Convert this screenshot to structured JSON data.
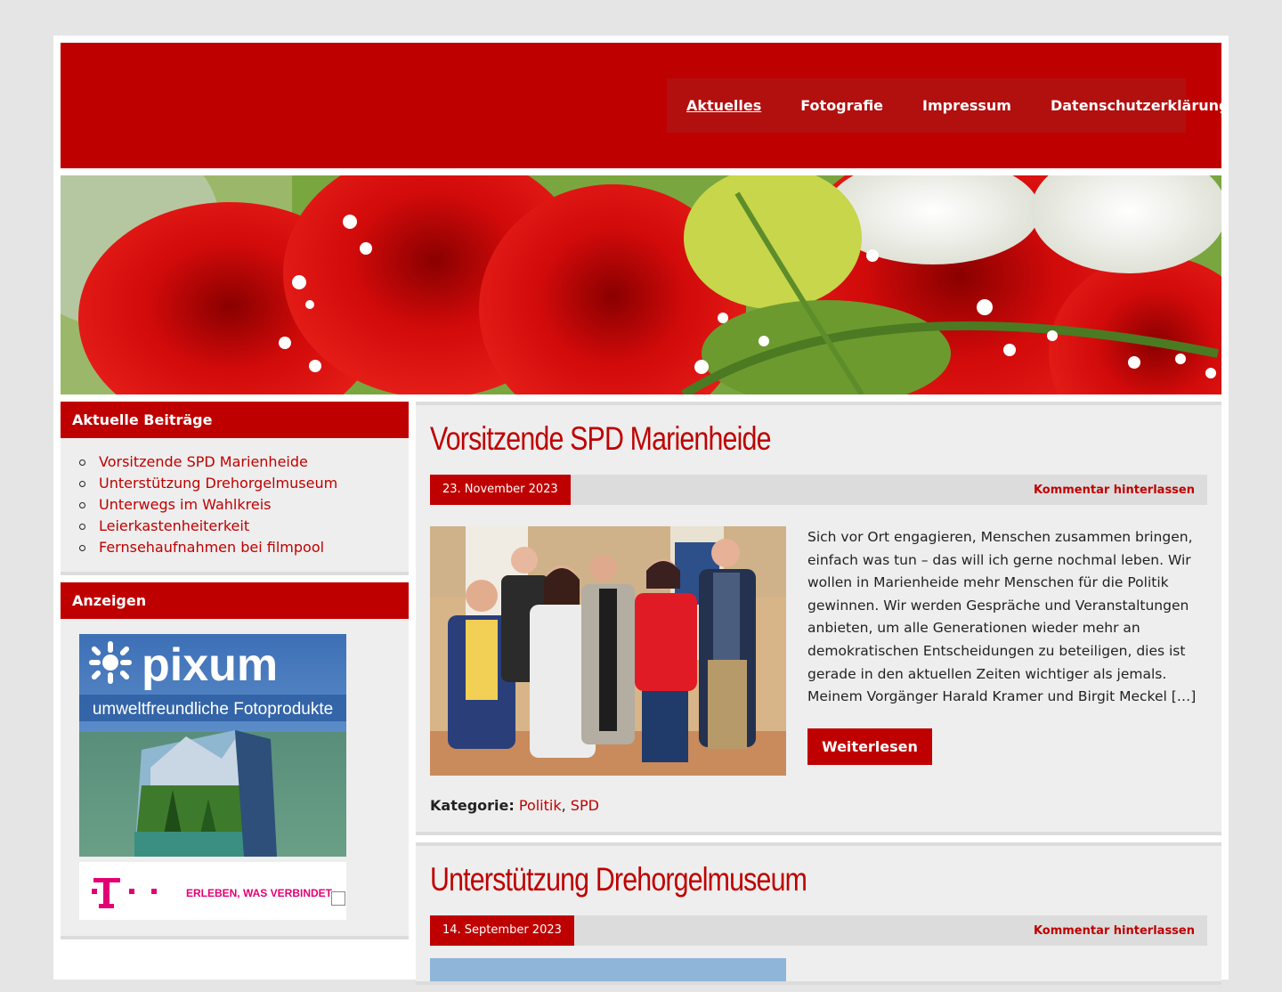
{
  "nav": {
    "items": [
      "Aktuelles",
      "Fotografie",
      "Impressum",
      "Datenschutzerklärung"
    ]
  },
  "sidebar": {
    "recent": {
      "title": "Aktuelle Beiträge",
      "items": [
        "Vorsitzende SPD Marienheide",
        "Unterstützung Drehorgelmuseum",
        "Unterwegs im Wahlkreis",
        "Leierkastenheiterkeit",
        "Fernsehaufnahmen bei filmpool"
      ]
    },
    "ads": {
      "title": "Anzeigen",
      "pixum_brand": "pixum",
      "pixum_tagline": "umweltfreundliche Fotoprodukte",
      "telekom_slogan": "ERLEBEN, WAS VERBINDET."
    }
  },
  "posts": [
    {
      "title": "Vorsitzende SPD Marienheide",
      "date": "23. November 2023",
      "comment": "Kommentar hinterlassen",
      "excerpt": "Sich vor Ort engagieren, Menschen zusammen bringen, einfach was tun – das will ich gerne nochmal leben. Wir wollen in Marienheide mehr Menschen für die Politik gewinnen. Wir werden Gespräche und Veranstaltungen anbieten, um alle Generationen wieder mehr an demokratischen Entscheidungen zu beteiligen, dies ist gerade in den aktuellen Zeiten wichtiger als jemals. Meinem Vorgänger Harald Kramer und Birgit Meckel […]",
      "read_more": "Weiterlesen",
      "category_label": "Kategorie:",
      "categories": [
        "Politik",
        "SPD"
      ]
    },
    {
      "title": "Unterstützung Drehorgelmuseum",
      "date": "14. September 2023",
      "comment": "Kommentar hinterlassen"
    }
  ],
  "colors": {
    "brand_red": "#bf0000",
    "nav_bg": "#b20f0f",
    "panel_bg": "#eeeeee"
  }
}
